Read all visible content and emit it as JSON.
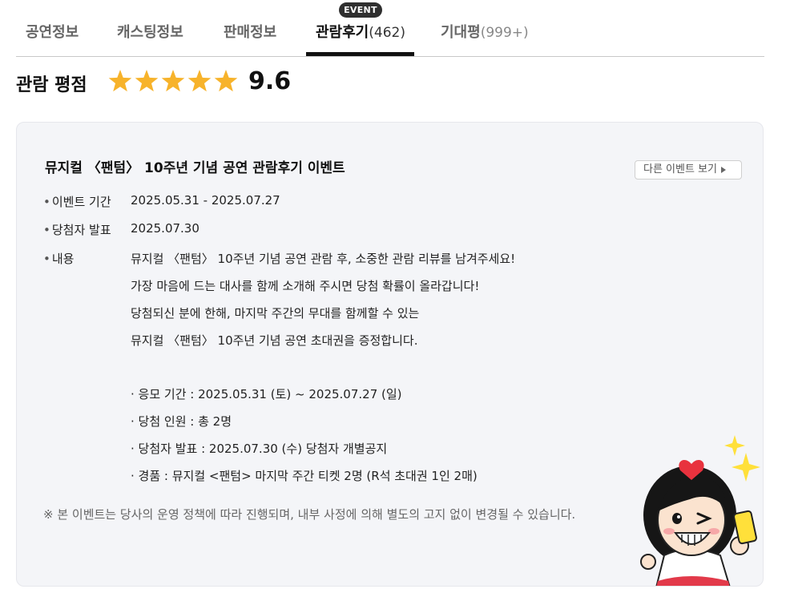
{
  "tabs": [
    {
      "label": "공연정보",
      "count": ""
    },
    {
      "label": "캐스팅정보",
      "count": ""
    },
    {
      "label": "판매정보",
      "count": ""
    },
    {
      "label": "관람후기",
      "count": "(462)"
    },
    {
      "label": "기대평",
      "count": "(999+)"
    }
  ],
  "active_tab": "관람후기",
  "event_badge": "EVENT",
  "rating": {
    "label": "관람 평점",
    "score": "9.6",
    "stars_filled": 5,
    "stars_total": 5,
    "star_color": "#F7B32B"
  },
  "event": {
    "title": "뮤지컬 〈팬텀〉 10주년 기념 공연 관람후기 이벤트",
    "more_button": "다른 이벤트 보기",
    "period_label": "이벤트 기간",
    "period_value": "2025.05.31 - 2025.07.27",
    "winner_label": "당첨자 발표",
    "winner_value": "2025.07.30",
    "content_label": "내용",
    "content_lines": [
      "뮤지컬 〈팬텀〉 10주년 기념 공연 관람 후, 소중한 관람 리뷰를 남겨주세요!",
      "가장 마음에 드는 대사를 함께 소개해 주시면 당첨 확률이 올라갑니다!",
      "당첨되신 분에 한해, 마지막 주간의 무대를 함께할 수 있는",
      "뮤지컬 〈팬텀〉 10주년 기념 공연 초대권을 증정합니다."
    ],
    "details": [
      "· 응모 기간 : 2025.05.31 (토) ~ 2025.07.27 (일)",
      "· 당첨 인원 : 총 2명",
      "· 당첨자 발표 : 2025.07.30 (수) 당첨자 개별공지",
      "· 경품 : 뮤지컬 <팬텀> 마지막 주간 티켓 2명 (R석 초대권 1인 2매)"
    ],
    "notice": "※ 본 이벤트는 당사의 운영 정책에 따라 진행되며, 내부 사정에 의해 별도의 고지 없이 변경될 수 있습니다."
  },
  "colors": {
    "card_bg": "#f4f5f8",
    "active_indicator": "#111111",
    "badge_bg": "#2f2f2f"
  }
}
